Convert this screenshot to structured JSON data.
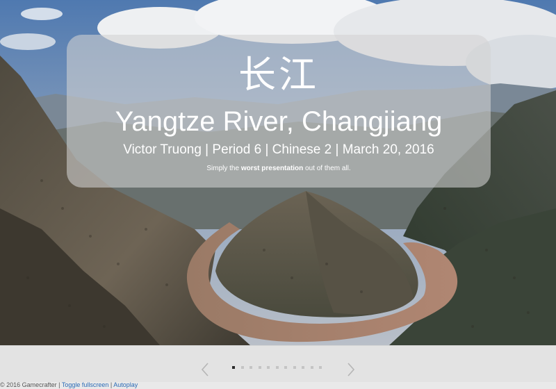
{
  "slide": {
    "chinese_title": "长江",
    "english_title": "Yangtze River, Changjiang",
    "byline": "Victor Truong | Period 6 | Chinese 2 | March 20, 2016",
    "tagline_before": "Simply the ",
    "tagline_bold": "worst presentation",
    "tagline_after": " out of them all.",
    "background_image": "river-valley-photo"
  },
  "navigation": {
    "prev_icon": "chevron-left-icon",
    "next_icon": "chevron-right-icon",
    "slide_count": 11,
    "current_slide": 1
  },
  "footer": {
    "copyright": "© 2016 Gamecrafter",
    "separator": " | ",
    "toggle_fullscreen": "Toggle fullscreen",
    "autoplay": "Autoplay"
  },
  "colors": {
    "link": "#2a6ab6",
    "card_overlay": "rgba(210,210,210,0.58)",
    "active_dot": "#2b2b2b",
    "inactive_dot": "#c4c4c4"
  }
}
